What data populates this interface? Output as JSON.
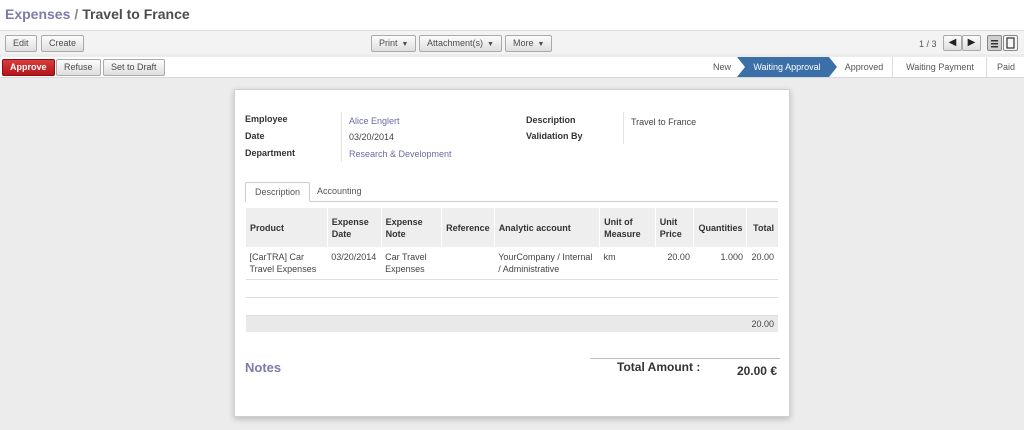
{
  "breadcrumb": {
    "parent": "Expenses",
    "separator": "/",
    "current": "Travel to France"
  },
  "toolbar": {
    "edit": "Edit",
    "create": "Create",
    "print": "Print",
    "attachments": "Attachment(s)",
    "more": "More",
    "pager": "1 / 3",
    "prev_icon": "◀",
    "next_icon": "▶"
  },
  "statusbar": {
    "approve": "Approve",
    "refuse": "Refuse",
    "set_to_draft": "Set to Draft",
    "stages": [
      "New",
      "Waiting Approval",
      "Approved",
      "Waiting Payment",
      "Paid"
    ],
    "active_stage": "Waiting Approval"
  },
  "form": {
    "employee_label": "Employee",
    "employee": "Alice Englert",
    "date_label": "Date",
    "date": "03/20/2014",
    "department_label": "Department",
    "department": "Research & Development",
    "description_label": "Description",
    "description": "Travel to France",
    "validation_label": "Validation By",
    "validation": ""
  },
  "tabs": [
    "Description",
    "Accounting"
  ],
  "lines": {
    "columns": [
      "Product",
      "Expense Date",
      "Expense Note",
      "Reference",
      "Analytic account",
      "Unit of Measure",
      "Unit Price",
      "Quantities",
      "Total"
    ],
    "rows": [
      {
        "product": "[CarTRA] Car Travel Expenses",
        "date": "03/20/2014",
        "note": "Car Travel Expenses",
        "reference": "",
        "analytic": "YourCompany / Internal / Administrative",
        "uom": "km",
        "unit_price": "20.00",
        "quantity": "1.000",
        "total": "20.00"
      }
    ],
    "footer_total": "20.00"
  },
  "notes_label": "Notes",
  "total_label": "Total Amount :",
  "total_value": "20.00 €",
  "colors": {
    "brand": "#7c7bad",
    "approve": "#c0262b",
    "active_stage": "#3a6fa8"
  }
}
